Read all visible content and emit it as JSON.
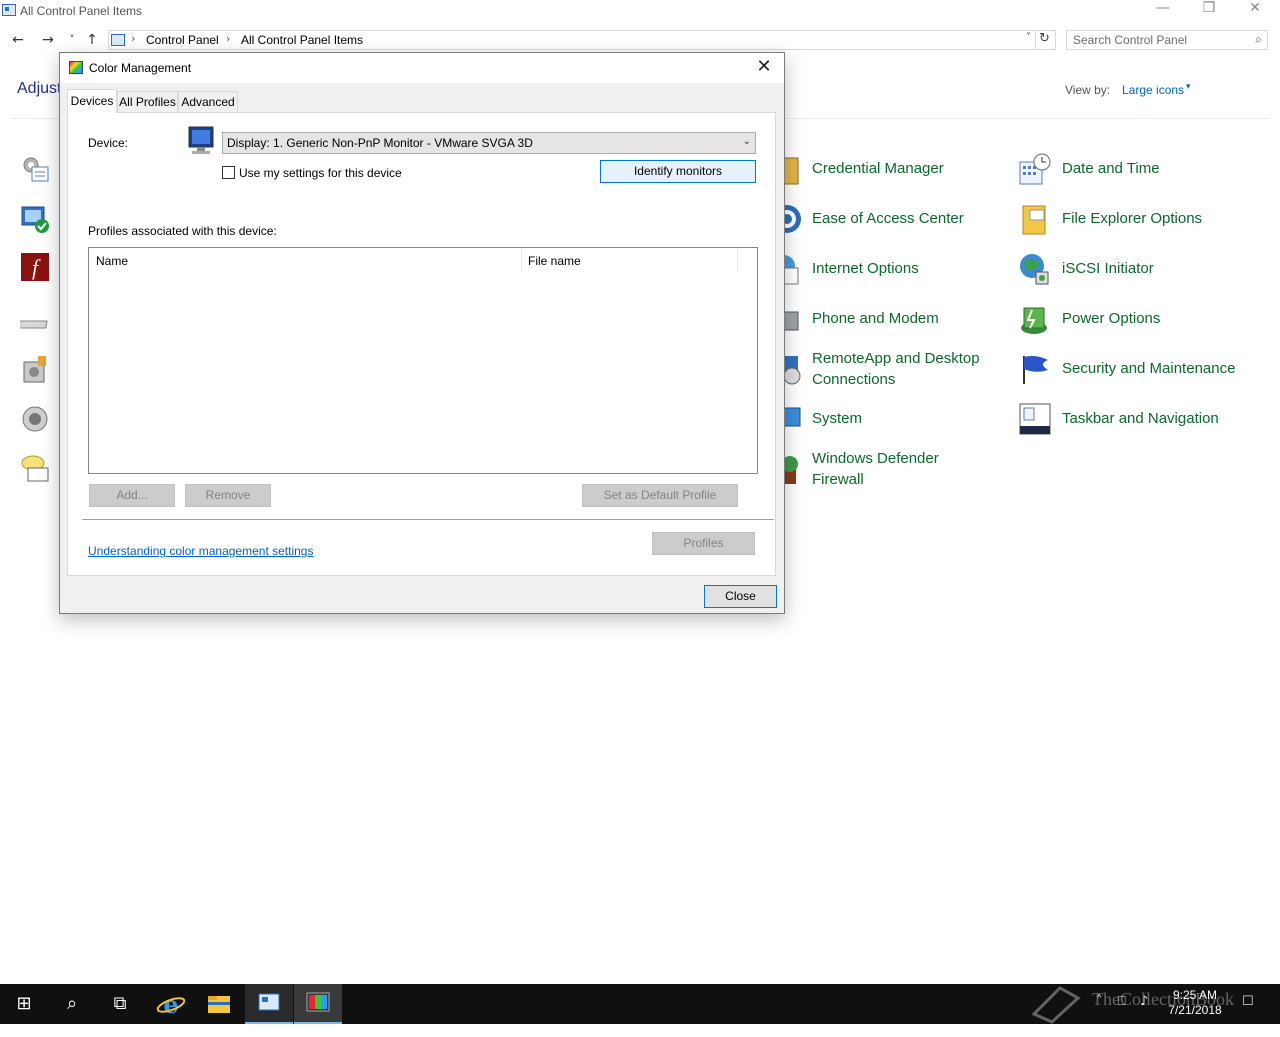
{
  "window": {
    "title": "All Control Panel Items",
    "controls": {
      "minimize": "—",
      "restore": "❐",
      "close": "✕"
    }
  },
  "address_bar": {
    "back": "←",
    "forward": "→",
    "recent": "˅",
    "up": "↑",
    "crumbs": [
      "Control Panel",
      "All Control Panel Items"
    ],
    "separator": "›",
    "dropdown": "˅",
    "refresh": "↻",
    "search_placeholder": "Search Control Panel",
    "search_glyph": "⌕"
  },
  "header": {
    "heading": "Adjust",
    "view_by_label": "View by:",
    "view_by_value": "Large icons",
    "view_by_caret": "▾"
  },
  "items": {
    "col2": [
      "Credential Manager",
      "Ease of Access Center",
      "Internet Options",
      "Phone and Modem",
      "RemoteApp and Desktop Connections",
      "System",
      "Windows Defender Firewall"
    ],
    "col3": [
      "Date and Time",
      "File Explorer Options",
      "iSCSI Initiator",
      "Power Options",
      "Security and Maintenance",
      "Taskbar and Navigation"
    ]
  },
  "dialog": {
    "title": "Color Management",
    "close_glyph": "✕",
    "tabs": [
      "Devices",
      "All Profiles",
      "Advanced"
    ],
    "device_label": "Device:",
    "device_value": "Display: 1. Generic Non-PnP Monitor - VMware SVGA 3D",
    "device_arrow": "⌵",
    "use_settings_label": "Use my settings for this device",
    "identify_label": "Identify monitors",
    "profiles_label": "Profiles associated with this device:",
    "columns": [
      "Name",
      "File name"
    ],
    "add_label": "Add...",
    "remove_label": "Remove",
    "set_default_label": "Set as Default Profile",
    "link_label": "Understanding color management settings",
    "profiles_label_btn": "Profiles",
    "close_label": "Close"
  },
  "taskbar": {
    "start_glyph": "⊞",
    "search_glyph": "⌕",
    "taskview_glyph": "⧉",
    "time": "9:25 AM",
    "date": "7/21/2018",
    "watermark": "TheCollectionBook",
    "tray": {
      "up": "˄",
      "network": "⎕",
      "volume": "♪",
      "notify": "☐"
    }
  },
  "colors": {
    "accent": "#0078d7",
    "link": "#0066cc",
    "cp_item": "#0a6a2a",
    "taskbar": "#101010"
  }
}
